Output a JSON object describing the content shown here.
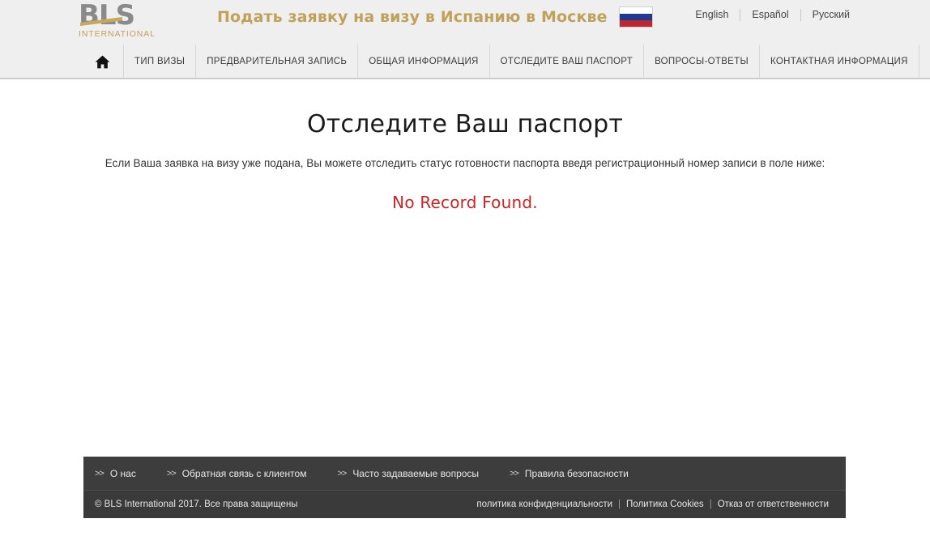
{
  "header": {
    "logo": {
      "main_text": "BLS",
      "sub_text": "INTERNATIONAL"
    },
    "title": "Подать заявку на визу в Испанию в Москве",
    "flag_name": "russia-flag",
    "languages": [
      {
        "label": "English"
      },
      {
        "label": "Español"
      },
      {
        "label": "Русский"
      }
    ]
  },
  "nav": {
    "home_icon": "home-icon",
    "items": [
      {
        "label": "ТИП ВИЗЫ",
        "name": "nav-item-visa-type"
      },
      {
        "label": "ПРЕДВАРИТЕЛЬНАЯ ЗАПИСЬ",
        "name": "nav-item-appointment"
      },
      {
        "label": "ОБЩАЯ ИНФОРМАЦИЯ",
        "name": "nav-item-general-info"
      },
      {
        "label": "ОТСЛЕДИТЕ ВАШ ПАСПОРТ",
        "name": "nav-item-track-passport"
      },
      {
        "label": "ВОПРОСЫ-ОТВЕТЫ",
        "name": "nav-item-faq"
      },
      {
        "label": "КОНТАКТНАЯ ИНФОРМАЦИЯ",
        "name": "nav-item-contact-info"
      }
    ]
  },
  "main": {
    "page_title": "Отследите Ваш паспорт",
    "description": "Если Ваша заявка на визу уже подана, Вы можете отследить статус готовности паспорта введя регистрационный номер записи в поле ниже:",
    "status_message": "No Record Found.",
    "status_color": "#cc2222"
  },
  "footer": {
    "links": [
      {
        "label": "О нас",
        "name": "footer-link-about-us"
      },
      {
        "label": "Обратная связь с клиентом",
        "name": "footer-link-customer-feedback"
      },
      {
        "label": "Часто задаваемые вопросы",
        "name": "footer-link-faq"
      },
      {
        "label": "Правила безопасности",
        "name": "footer-link-security-rules"
      }
    ],
    "chevron": ">>",
    "copyright": "© BLS International 2017. Все права защищены",
    "policy_links": [
      {
        "label": "политика конфиденциальности",
        "name": "footer-link-privacy-policy"
      },
      {
        "label": "Политика Cookies",
        "name": "footer-link-cookies-policy"
      },
      {
        "label": "Отказ от ответственности",
        "name": "footer-link-disclaimer"
      }
    ],
    "policy_separator": "|"
  }
}
